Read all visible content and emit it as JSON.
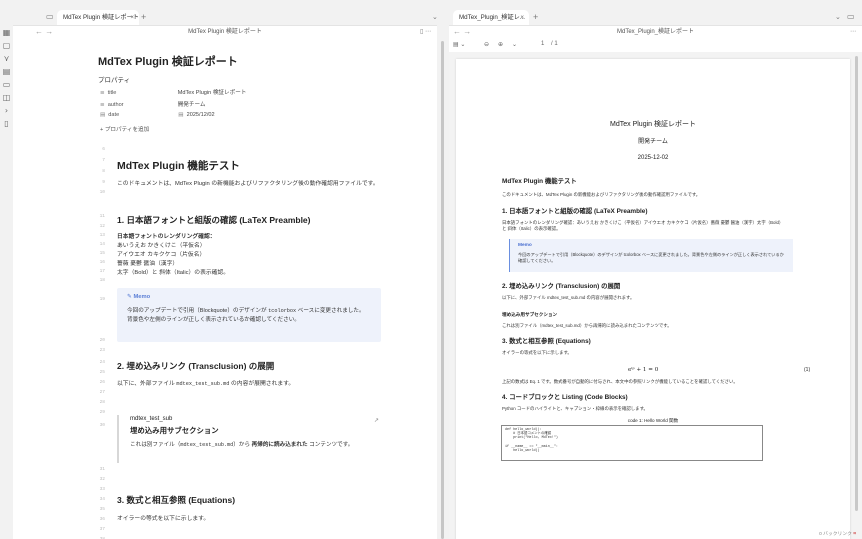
{
  "ribbon": {
    "icons": [
      "layout-icon",
      "file-icon",
      "graph-icon",
      "calendar-icon",
      "template-icon",
      "bookmark-icon",
      "terminal-icon",
      "publish-icon"
    ]
  },
  "left_tab": {
    "title": "MdTex Plugin 検証レポート",
    "close": "×"
  },
  "right_tab": {
    "title": "MdTex_Plugin_検証レ...",
    "close": "×"
  },
  "left_view_header": {
    "title": "MdTex Plugin 検証レポート"
  },
  "right_view_header": {
    "title": "MdTex_Plugin_検証レポート"
  },
  "pdf_toolbar": {
    "page": "1",
    "total": "/ 1"
  },
  "editor": {
    "title": "MdTex Plugin 検証レポート",
    "properties_heading": "プロパティ",
    "properties": [
      {
        "key": "title",
        "value": "MdTex Plugin 検証レポート"
      },
      {
        "key": "author",
        "value": "開発チーム"
      },
      {
        "key": "date",
        "value": "2025/12/02"
      }
    ],
    "add_property": "+ プロパティを追加",
    "line_numbers": [
      "6",
      "7",
      "8",
      "9",
      "10",
      "11",
      "12",
      "13",
      "14",
      "15",
      "16",
      "17",
      "18",
      "19",
      "20",
      "23",
      "24",
      "25",
      "26",
      "27",
      "28",
      "29",
      "30",
      "31",
      "32",
      "33",
      "34",
      "35",
      "36",
      "37",
      "38"
    ],
    "h1": "MdTex Plugin 機能テスト",
    "intro": "このドキュメントは、MdTex Plugin の新機能およびリファクタリング後の動作確認用ファイルです。",
    "sec1_title": "1. 日本語フォントと組版の確認 (LaTeX Preamble)",
    "sec1_lines": [
      "日本語フォントのレンダリング確認：",
      "あいうえお かきくけこ（平仮名）",
      "アイウエオ カキクケコ（片仮名）",
      "薔薇 憂鬱 醤油（漢字）",
      "太字（Bold）と 斜体（Italic）の表示確認。"
    ],
    "memo_title": "Memo",
    "memo_body_1": "今回のアップデートで引用（Blockquote）のデザインが",
    "memo_code": "tcolorbox",
    "memo_body_2": "ベースに変更されました。",
    "memo_body_3": "背景色や左側のラインが正しく表示されているか確認してください。",
    "sec2_title": "2. 埋め込みリンク (Transclusion) の展開",
    "sec2_text_1": "以下に、外部ファイル",
    "sec2_code": "mdtex_test_sub.md",
    "sec2_text_2": "の内容が展開されます。",
    "embed_file": "mdtex_test_sub",
    "embed_heading": "埋め込み用サブセクション",
    "embed_text_1": "これは別ファイル（",
    "embed_code": "mdtex_test_sub.md",
    "embed_text_2": "）から",
    "embed_bold": "再帰的に読み込まれた",
    "embed_text_3": "コンテンツです。",
    "sec3_title": "3. 数式と相互参照 (Equations)",
    "sec3_text": "オイラーの等式を以下に示します。"
  },
  "pdf": {
    "title": "MdTex Plugin 検証レポート",
    "author": "開発チーム",
    "date": "2025-12-02",
    "h_main": "MdTex Plugin 機能テスト",
    "intro": "このドキュメントは、MdTex Plugin の新機能およびリファクタリング後の動作確認用ファイルです。",
    "s1": "1. 日本語フォントと組版の確認 (LaTeX Preamble)",
    "s1_text_a": "日本語フォントのレンダリング確認：あいうえお かきくけこ（平仮名）アイウエオ カキクケコ（片仮名）薔薇 憂鬱 醤油（漢字）太字（Bold）",
    "s1_text_b": "と 斜体（Italic）の表示確認。",
    "memo_title": "Memo",
    "memo_text": "今回のアップデートで引用（Blockquote）のデザインが tcolorbox ベースに変更されました。背景色や左側のラインが正しく表示されているか確認してください。",
    "s2": "2. 埋め込みリンク (Transclusion) の展開",
    "s2_text": "以下に、外部ファイル mdtex_test_sub.md の内容が展開されます。",
    "sub": "埋め込み用サブセクション",
    "sub_text": "これは別ファイル（mdtex_test_sub.md）から再帰的に読み込まれたコンテンツです。",
    "s3": "3. 数式と相互参照 (Equations)",
    "s3_text": "オイラーの等式を以下に示します。",
    "equation": "eⁱᵖ + 1 = 0",
    "eq_number": "(1)",
    "eq_text": "上記の数式は Eq. 1 です。数式番号が自動的に付与され、本文中の参照リンクが機能していることを確認してください。",
    "s4": "4. コードブロックと Listing (Code Blocks)",
    "s4_text": "Python コードのハイライトと、キャプション・枠線の表示を確認します。",
    "code_caption": "code 1: Hello World 関数",
    "code_lines": [
      "def hello_world():",
      "    # 日本語コメントの確認",
      "    print(\"Hello, MdTex!\")",
      "",
      "if __name__ == \"__main__\":",
      "    hello_world()"
    ],
    "backlink": "0 バックリンク"
  }
}
